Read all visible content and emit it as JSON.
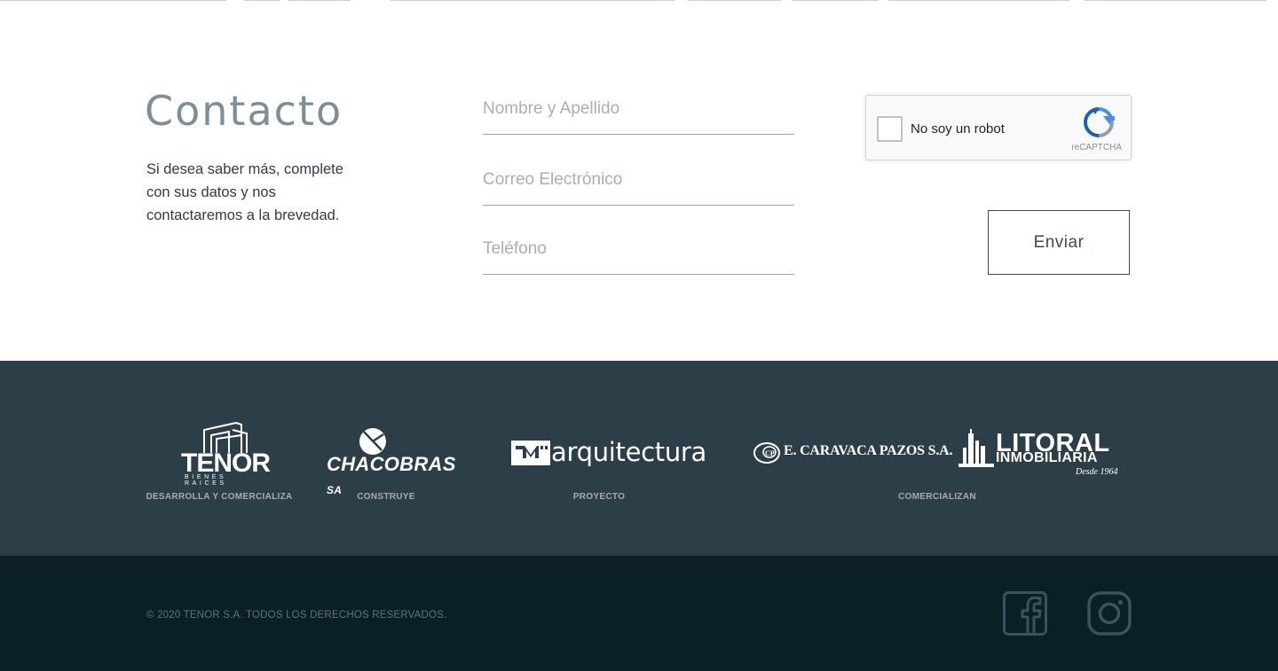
{
  "contact": {
    "title": "Contacto",
    "description": "Si desea saber más, complete con sus datos y nos contactaremos a la brevedad.",
    "fields": {
      "name_placeholder": "Nombre y Apellido",
      "email_placeholder": "Correo Electrónico",
      "phone_placeholder": "Teléfono"
    },
    "recaptcha": {
      "label": "No soy un robot",
      "brand": "reCAPTCHA"
    },
    "send_label": "Enviar"
  },
  "partners": {
    "tenor": {
      "caption": "DESARROLLA Y COMERCIALIZA"
    },
    "chacobras": {
      "caption": "CONSTRUYE"
    },
    "arquitectura": {
      "caption": "PROYECTO"
    },
    "comercializan_caption": "COMERCIALIZAN"
  },
  "footer": {
    "copyright": "© 2020 TENOR S.A. TODOS LOS DERECHOS RESERVADOS.",
    "social": [
      {
        "icon": "facebook-icon"
      },
      {
        "icon": "instagram-icon"
      }
    ]
  },
  "colors": {
    "partners_bg": "#2c3e48",
    "footer_bg": "#0b1f27",
    "title": "#7e8e96",
    "text": "#2f3c43"
  }
}
